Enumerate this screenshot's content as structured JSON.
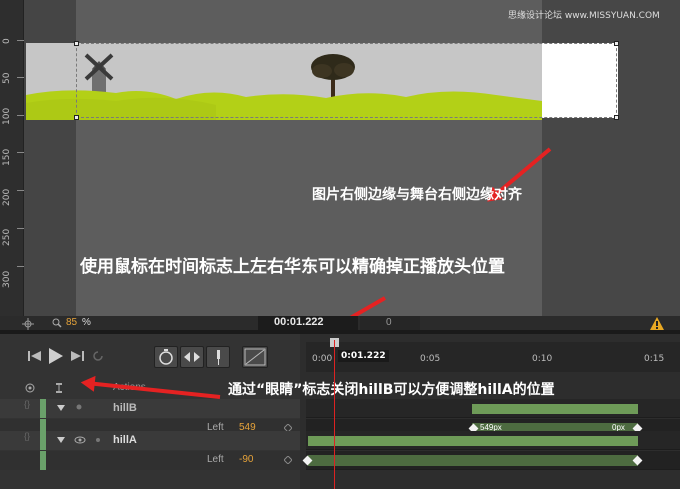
{
  "watermark": "思缘设计论坛 www.MISSYUAN.COM",
  "ruler": {
    "ticks": [
      "0",
      "50",
      "100",
      "150",
      "200",
      "250",
      "300"
    ]
  },
  "annotations": {
    "stage_edge": "图片右侧边缘与舞台右侧边缘对齐",
    "time_marker": "使用鼠标在时间标志上左右华东可以精确掉正播放头位置",
    "eye_toggle": "通过“眼睛”标志关闭hillB可以方便调整hillA的位置"
  },
  "status": {
    "zoom_value": "85",
    "zoom_unit": "%",
    "timecode": "00:01.222",
    "time_secondary": "0"
  },
  "timeline": {
    "ruler_labels": [
      "0:00",
      "0:05",
      "0:10",
      "0:15"
    ],
    "playhead_label": "0:01.222",
    "actions_header": "Actions",
    "layers": [
      {
        "name": "hillB",
        "prop_label": "Left",
        "prop_value": "549",
        "bar_start_label": "549px",
        "bar_end_label": "0px"
      },
      {
        "name": "hillA",
        "prop_label": "Left",
        "prop_value": "-90"
      }
    ]
  },
  "colors": {
    "accent": "#c08a16",
    "annotation_arrow": "#e52222",
    "layer_bar": "#5d8c4a",
    "playhead": "#dd2222"
  }
}
